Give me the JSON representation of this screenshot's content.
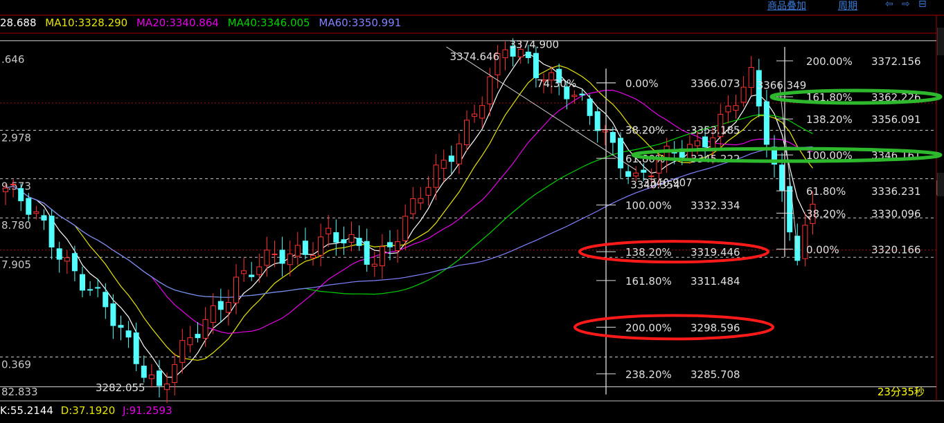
{
  "toolbar": {
    "overlay_label": "商品叠加",
    "period_label": "周期",
    "nav_buttons": [
      "⇦",
      "⇨",
      "⊟"
    ]
  },
  "ma_legend": {
    "ma5": "28.688",
    "ma10": "MA10:3328.290",
    "ma20": "MA20:3340.864",
    "ma40": "MA40:3346.005",
    "ma60": "MA60:3350.991"
  },
  "kdj_legend": {
    "k": "K:55.2144",
    "d": "D:37.1920",
    "j": "J:91.2593"
  },
  "countdown": "23分35秒",
  "colors": {
    "background": "#000000",
    "up_candle": "#ff3232",
    "down_candle": "#54ffff",
    "ma5": "#ffffff",
    "ma10": "#e6e600",
    "ma20": "#e600e6",
    "ma40": "#00d200",
    "ma60": "#8282ff",
    "fib_text": "#ffffff",
    "grid": "#c0c0c0",
    "highlight_red": "#ff1a1a",
    "highlight_green": "#2db82d"
  },
  "chart_data": {
    "type": "candlestick",
    "y_axis_labels": [
      ".646",
      "2.978",
      "9.573",
      "8.780",
      "7.905",
      "0.369",
      "82.833"
    ],
    "y_axis_values": [
      3374.646,
      3352.978,
      3339.573,
      3328.78,
      3317.905,
      3290.369,
      3282.833
    ],
    "ylim": [
      3279.2,
      3379.4
    ],
    "price_annotations": [
      {
        "text": "3374.900",
        "value": 3374.9,
        "bar": 65
      },
      {
        "text": "3374.646",
        "value": 3374.646,
        "bar": 65
      },
      {
        "text": "3282.055",
        "value": 3282.055,
        "bar": 20
      },
      {
        "text": "3340.907",
        "value": 3340.907,
        "bar": 82
      },
      {
        "text": "3340.354",
        "value": 3340.354,
        "bar": 82
      },
      {
        "text": "3366.349",
        "value": 3366.349,
        "bar": 97
      }
    ],
    "fibonacci_sets": [
      {
        "levels": [
          {
            "pct": "74.30%",
            "price": "",
            "value": 3366.073
          },
          {
            "pct": "0.00%",
            "price": "3366.073",
            "value": 3366.073
          },
          {
            "pct": "38.20%",
            "price": "3353.185",
            "value": 3353.185
          },
          {
            "pct": "61.80%",
            "price": "3345.222",
            "value": 3345.222
          },
          {
            "pct": "100.00%",
            "price": "3332.334",
            "value": 3332.334
          },
          {
            "pct": "138.20%",
            "price": "3319.446",
            "value": 3319.446
          },
          {
            "pct": "161.80%",
            "price": "3311.484",
            "value": 3311.484
          },
          {
            "pct": "200.00%",
            "price": "3298.596",
            "value": 3298.596
          },
          {
            "pct": "238.20%",
            "price": "3285.708",
            "value": 3285.708
          }
        ]
      },
      {
        "levels": [
          {
            "pct": "200.00%",
            "price": "3372.156",
            "value": 3372.156
          },
          {
            "pct": "161.80%",
            "price": "3362.226",
            "value": 3362.226
          },
          {
            "pct": "138.20%",
            "price": "3356.091",
            "value": 3356.091
          },
          {
            "pct": "100.00%",
            "price": "3346.161",
            "value": 3346.161
          },
          {
            "pct": "61.80%",
            "price": "3336.231",
            "value": 3336.231
          },
          {
            "pct": "38.20%",
            "price": "3330.096",
            "value": 3330.096
          },
          {
            "pct": "0.00%",
            "price": "3320.166",
            "value": 3320.166
          }
        ]
      }
    ],
    "dashed_levels": [
      3352.978,
      3339.573,
      3328.78,
      3317.905,
      3290.369
    ],
    "red_dashed_levels": [
      3360.5,
      3319.9
    ],
    "highlights": [
      {
        "color": "red",
        "fib_level": "138.20%"
      },
      {
        "color": "red",
        "fib_level": "200.00%"
      },
      {
        "color": "green",
        "fib_level": "161.80%"
      },
      {
        "color": "green",
        "fib_level": "100.00%"
      }
    ],
    "anchor_points": [
      {
        "bar": 20,
        "price": 3282.055
      },
      {
        "bar": 65,
        "price": 3374.9
      },
      {
        "bar": 82,
        "price": 3340.354
      },
      {
        "bar": 97,
        "price": 3366.349
      },
      {
        "bar": 103,
        "price": 3320.166
      }
    ],
    "grid": false
  }
}
